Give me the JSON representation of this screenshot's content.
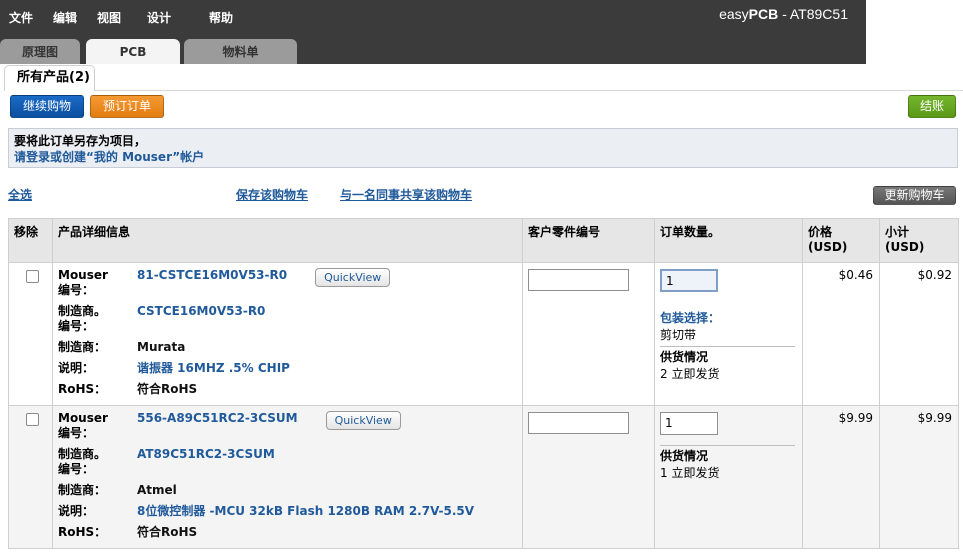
{
  "menu": [
    "文件",
    "编辑",
    "视图",
    "设计",
    "帮助"
  ],
  "app_title": {
    "brand_light": "easy",
    "brand_bold": "PCB",
    "project": " - AT89C51"
  },
  "tabs": [
    "原理图",
    "PCB",
    "物料单"
  ],
  "subtab": "所有产品(2)",
  "buttons": {
    "continue": "继续购物",
    "preorder": "预订订单",
    "checkout": "结账",
    "update_cart": "更新购物车"
  },
  "notice": {
    "line1": "要将此订单另存为项目，",
    "line2": "请登录或创建“我的 Mouser”帐户"
  },
  "links": {
    "select_all": "全选",
    "save_cart": "保存该购物车",
    "share_cart": "与一名同事共享该购物车"
  },
  "table": {
    "headers": {
      "remove": "移除",
      "details": "产品详细信息",
      "customer_part": "客户零件编号",
      "qty": "订单数量。",
      "price": "价格\n(USD)",
      "subtotal": "小计\n(USD)"
    },
    "labels": {
      "mouser_no": "Mouser\n编号：",
      "mfr_no": "制造商。\n编号：",
      "mfr": "制造商：",
      "desc": "说明：",
      "rohs": "RoHS："
    },
    "quickview": "QuickView",
    "pkg_label": "包装选择：",
    "avail_title": "供货情况",
    "rows": [
      {
        "mouser_no": "81-CSTCE16M0V53-R0",
        "mfr_no": "CSTCE16M0V53-R0",
        "mfr": "Murata",
        "desc": "谐振器 16MHZ .5% CHIP",
        "rohs": "符合RoHS",
        "customer_part": "",
        "qty": "1",
        "pkg": "剪切带",
        "avail": "2 立即发货",
        "price": "$0.46",
        "subtotal": "$0.92"
      },
      {
        "mouser_no": "556-A89C51RC2-3CSUM",
        "mfr_no": "AT89C51RC2-3CSUM",
        "mfr": "Atmel",
        "desc": "8位微控制器 -MCU 32kB Flash 1280B RAM 2.7V-5.5V",
        "rohs": "符合RoHS",
        "customer_part": "",
        "qty": "1",
        "avail": "1 立即发货",
        "price": "$9.99",
        "subtotal": "$9.99"
      }
    ]
  }
}
